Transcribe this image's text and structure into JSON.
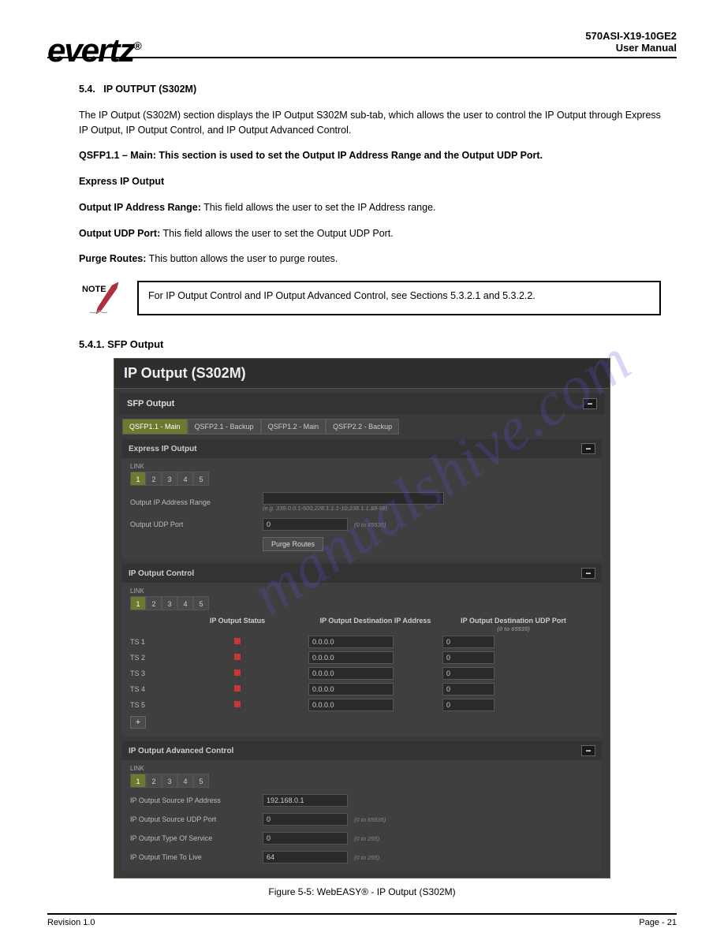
{
  "logo": "evertz",
  "logo_reg": "®",
  "doc_header_line1": "570ASI-X19-10GE2",
  "doc_header_line2": "User Manual",
  "section_num": "5.4.",
  "section_title": "IP OUTPUT (S302M)",
  "para1": "The IP Output (S302M) section displays the IP Output S302M sub-tab, which allows the user to control the IP Output through Express IP Output, IP Output Control, and IP Output Advanced Control.",
  "para2": "QSFP1.1 – Main: This section is used to set the Output IP Address Range and the Output UDP Port.",
  "express_heading": "Express IP Output",
  "defn_range_label": "Output IP Address Range:",
  "defn_range_text": " This field allows the user to set the IP Address range.",
  "defn_udp_label": "Output UDP Port:",
  "defn_udp_text": " This field allows the user to set the Output UDP Port.",
  "defn_purge_label": "Purge Routes:",
  "defn_purge_text": " This button allows the user to purge routes.",
  "note_text": "For IP Output Control and IP Output Advanced Control, see Sections 5.3.2.1 and 5.3.2.2.",
  "sfp_output_heading": "5.4.1. SFP Output",
  "screenshot": {
    "title": "IP Output (S302M)",
    "sfp_bar": "SFP Output",
    "collapse_glyph": "−",
    "plus_glyph": "+",
    "main_tabs": [
      "QSFP1.1 - Main",
      "QSFP2.1 - Backup",
      "QSFP1.2 - Main",
      "QSFP2.2 - Backup"
    ],
    "express": {
      "title": "Express IP Output",
      "link_label": "LINK",
      "links": [
        "1",
        "2",
        "3",
        "4",
        "5"
      ],
      "range_label": "Output IP Address Range",
      "range_hint": "(e.g. 239.0.0.1-500,228.1.1.1-10,238.1.1.88-98)",
      "udp_label": "Output UDP Port",
      "udp_value": "0",
      "udp_hint": "(0 to 65535)",
      "purge_btn": "Purge Routes"
    },
    "control": {
      "title": "IP Output Control",
      "link_label": "LINK",
      "links": [
        "1",
        "2",
        "3",
        "4",
        "5"
      ],
      "col1": "IP Output Status",
      "col2": "IP Output Destination IP Address",
      "col3": "IP Output Destination UDP Port",
      "col3_hint": "(0 to 65535)",
      "rows": [
        {
          "label": "TS 1",
          "ip": "0.0.0.0",
          "port": "0"
        },
        {
          "label": "TS 2",
          "ip": "0.0.0.0",
          "port": "0"
        },
        {
          "label": "TS 3",
          "ip": "0.0.0.0",
          "port": "0"
        },
        {
          "label": "TS 4",
          "ip": "0.0.0.0",
          "port": "0"
        },
        {
          "label": "TS 5",
          "ip": "0.0.0.0",
          "port": "0"
        }
      ]
    },
    "advanced": {
      "title": "IP Output Advanced Control",
      "link_label": "LINK",
      "links": [
        "1",
        "2",
        "3",
        "4",
        "5"
      ],
      "rows": [
        {
          "label": "IP Output Source IP Address",
          "value": "192.168.0.1",
          "hint": ""
        },
        {
          "label": "IP Output Source UDP Port",
          "value": "0",
          "hint": "(0 to 65535)"
        },
        {
          "label": "IP Output Type Of Service",
          "value": "0",
          "hint": "(0 to 255)"
        },
        {
          "label": "IP Output Time To Live",
          "value": "64",
          "hint": "(0 to 255)"
        }
      ]
    }
  },
  "figure_caption": "Figure 5-5: WebEASY® - IP Output (S302M)",
  "footer_left": "Revision 1.0",
  "footer_right": "Page - 21",
  "watermark": "manualshive.com"
}
